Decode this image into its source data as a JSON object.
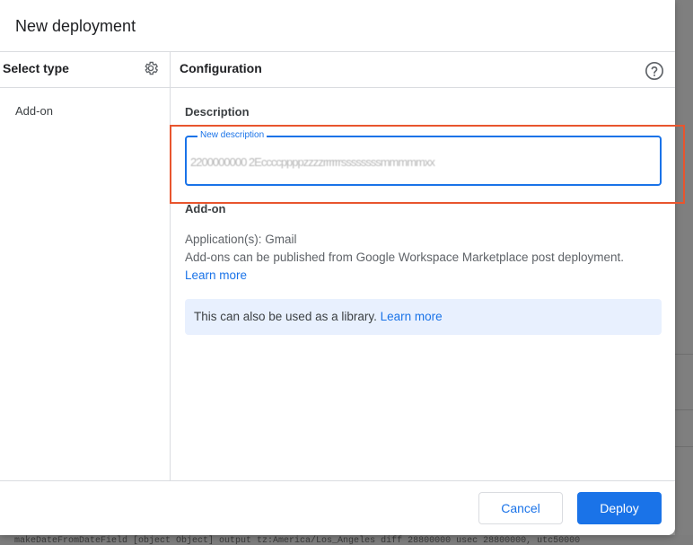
{
  "dialog": {
    "title": "New deployment",
    "left": {
      "header": "Select type",
      "settings_icon": "gear-icon",
      "types": [
        "Add-on"
      ]
    },
    "right": {
      "header": "Configuration",
      "help_icon": "help-circle-icon",
      "description_label": "Description",
      "description_field": {
        "label": "New description",
        "value": "2200000000 2Eccccppppzzzzrrrrrrssssssssmmmmmxx"
      },
      "addon_label": "Add-on",
      "applications": "Application(s): Gmail",
      "publish_note": "Add-ons can be published from Google Workspace Marketplace post deployment.",
      "learn_more": "Learn more",
      "library_notice": "This can also be used as a library.",
      "library_learn_more": "Learn more"
    },
    "footer": {
      "cancel_label": "Cancel",
      "deploy_label": "Deploy"
    }
  },
  "background": {
    "console_text": "makeDateFromDateField [object Object] output tz:America/Los_Angeles diff 28800000 usec 28800000, utc50000"
  },
  "colors": {
    "primary": "#1a73e8",
    "highlight": "#e8552e",
    "notice_bg": "#e8f0fe",
    "divider": "#dadce0"
  }
}
